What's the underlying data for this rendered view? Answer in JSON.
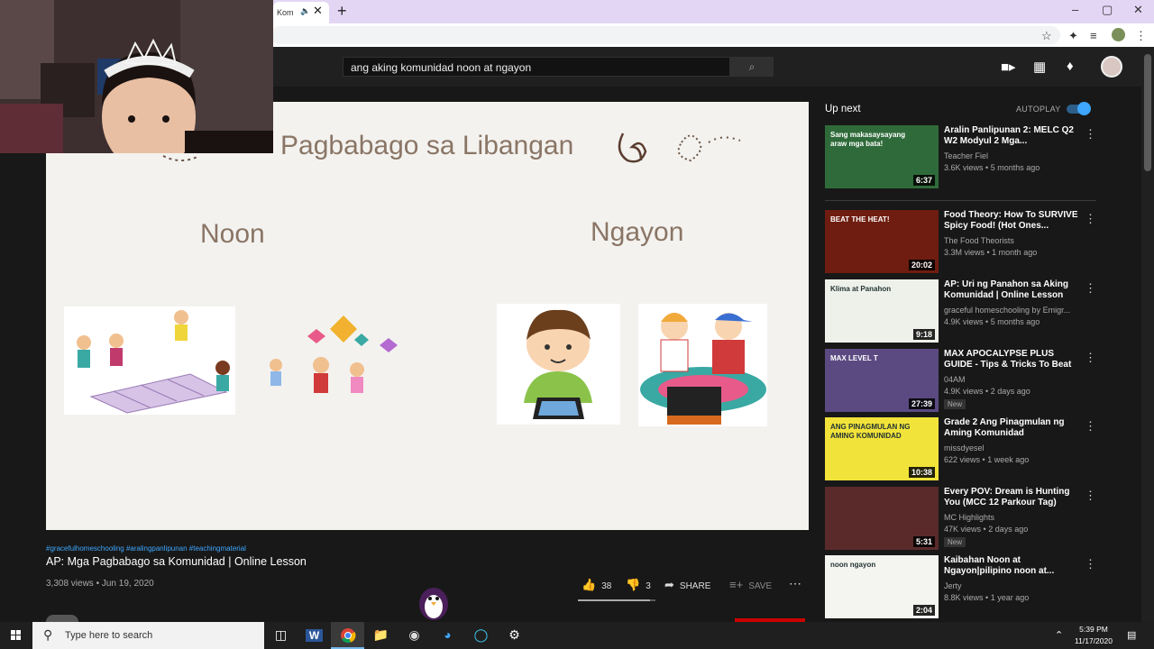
{
  "browser": {
    "tab_title": "Kom",
    "tab_audio_icon": "speaker-icon",
    "new_tab_symbol": "+",
    "window_controls": [
      "–",
      "▢",
      "✕"
    ]
  },
  "youtube": {
    "search_query": "ang aking komunidad noon at ngayon",
    "search_icon": "⌕",
    "header_icons": [
      "video-create-icon",
      "apps-icon",
      "notifications-icon"
    ]
  },
  "slide": {
    "title": "Pagbabago sa Libangan",
    "left_heading": "Noon",
    "right_heading": "Ngayon"
  },
  "video": {
    "hashtags": "#gracefulhomeschooling #aralingpanlipunan #teachingmaterial",
    "title": "AP: Mga Pagbabago sa Komunidad | Online Lesson",
    "views": "3,308 views",
    "date": "Jun 19, 2020",
    "likes": "38",
    "dislikes": "3",
    "share_label": "SHARE",
    "save_label": "SAVE",
    "like_ratio": 0.93
  },
  "upnext": {
    "title": "Up next",
    "autoplay_label": "AUTOPLAY",
    "autoplay_on": true,
    "items": [
      {
        "title": "Aralin Panlipunan 2: MELC Q2 W2 Modyul 2 Mga...",
        "channel": "Teacher Fiel",
        "views": "3.6K views",
        "age": "5 months ago",
        "duration": "6:37",
        "badge": "",
        "thumb_color": "#2f6b3a",
        "thumb_text": "Sang makasaysayang araw mga bata!"
      },
      {
        "title": "Food Theory: How To SURVIVE Spicy Food! (Hot Ones...",
        "channel": "The Food Theorists",
        "views": "3.3M views",
        "age": "1 month ago",
        "duration": "20:02",
        "badge": "",
        "thumb_color": "#6e1d10",
        "thumb_text": "BEAT THE HEAT!"
      },
      {
        "title": "AP: Uri ng Panahon sa Aking Komunidad | Online Lesson",
        "channel": "graceful homeschooling by Emigr...",
        "views": "4.9K views",
        "age": "5 months ago",
        "duration": "9:18",
        "badge": "",
        "thumb_color": "#eef1ea",
        "thumb_text": "Klima at Panahon"
      },
      {
        "title": "MAX APOCALYPSE PLUS GUIDE - Tips & Tricks To Beat Season...",
        "channel": "04AM",
        "views": "4.9K views",
        "age": "2 days ago",
        "duration": "27:39",
        "badge": "New",
        "thumb_color": "#5b4a82",
        "thumb_text": "MAX LEVEL T"
      },
      {
        "title": "Grade 2 Ang Pinagmulan ng Aming Komunidad",
        "channel": "missdyesel",
        "views": "622 views",
        "age": "1 week ago",
        "duration": "10:38",
        "badge": "",
        "thumb_color": "#f2e33a",
        "thumb_text": "ANG PINAGMULAN NG AMING KOMUNIDAD"
      },
      {
        "title": "Every POV: Dream is Hunting You (MCC 12 Parkour Tag)",
        "channel": "MC Highlights",
        "views": "47K views",
        "age": "2 days ago",
        "duration": "5:31",
        "badge": "New",
        "thumb_color": "#5a2a2a",
        "thumb_text": ""
      },
      {
        "title": "Kaibahan Noon at Ngayon|pilipino noon at...",
        "channel": "Jerty",
        "views": "8.8K views",
        "age": "1 year ago",
        "duration": "2:04",
        "badge": "",
        "thumb_color": "#f4f4f0",
        "thumb_text": "noon ngayon"
      }
    ]
  },
  "taskbar": {
    "search_placeholder": "Type here to search",
    "time": "5:39 PM",
    "date": "11/17/2020",
    "apps": [
      "task-view-icon",
      "word-icon",
      "chrome-icon",
      "file-explorer-icon",
      "obs-icon",
      "edge-icon",
      "cortana-icon",
      "settings-icon"
    ]
  }
}
